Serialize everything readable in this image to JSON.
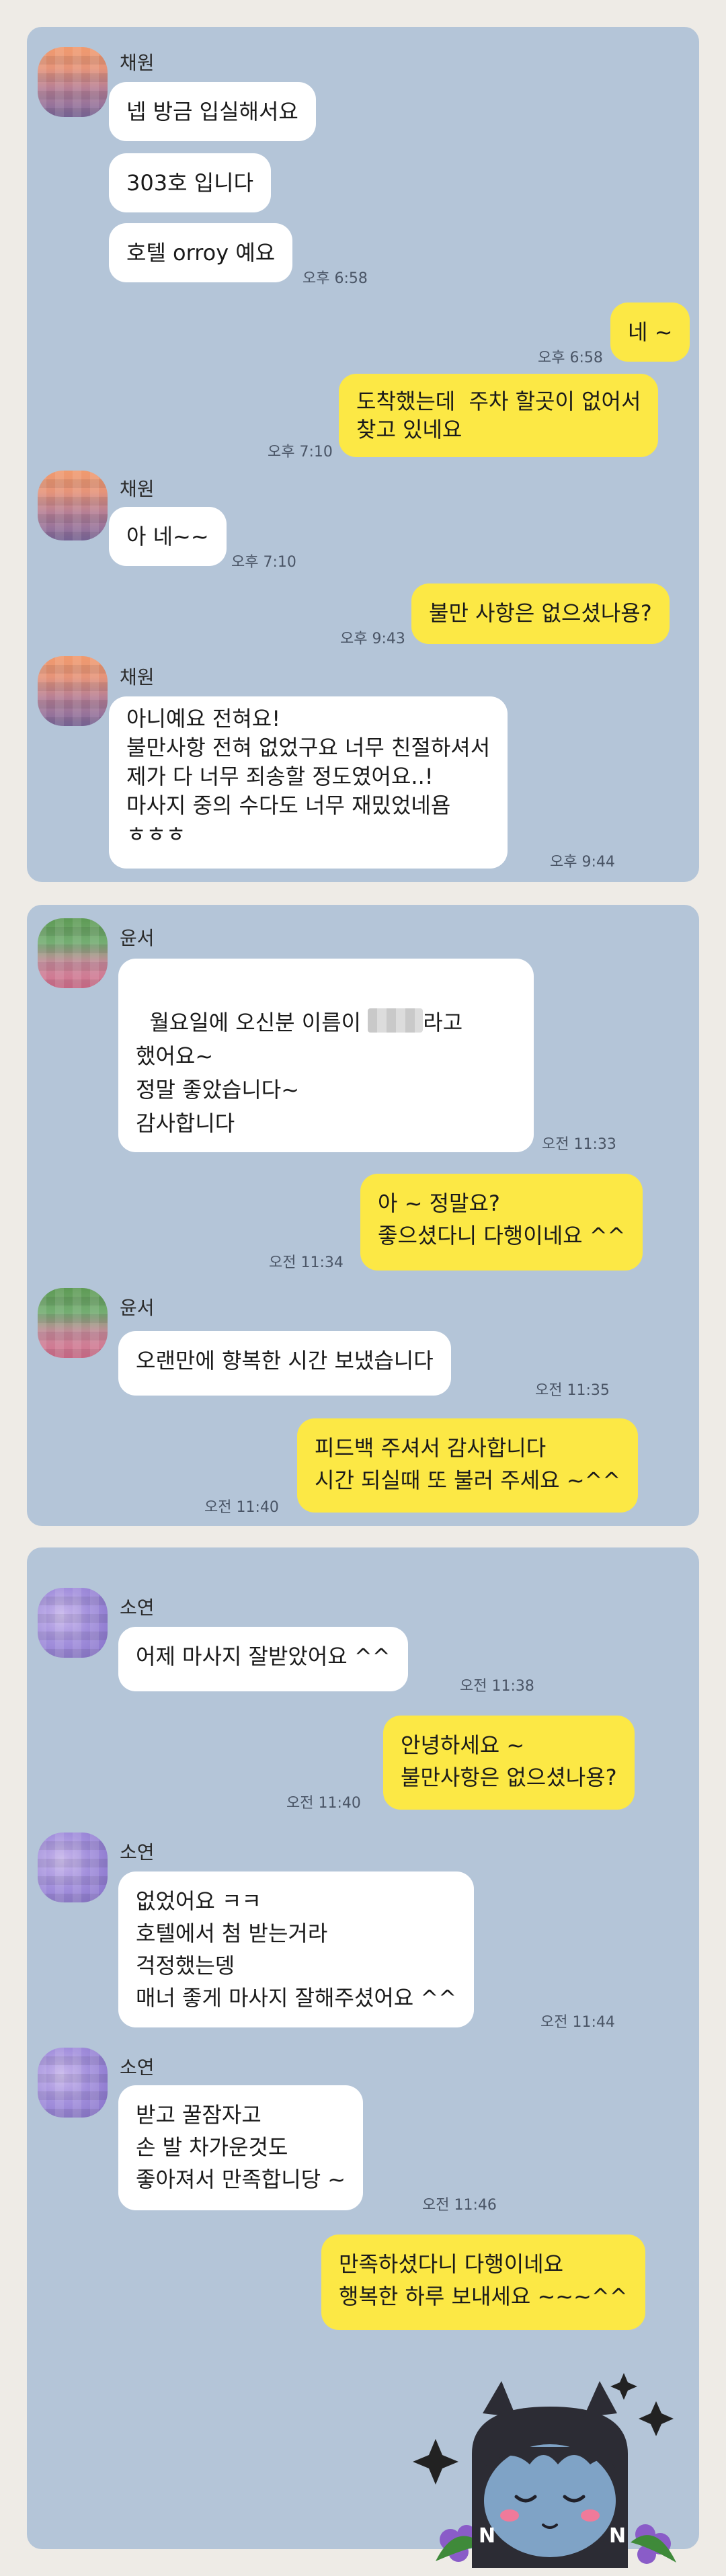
{
  "chat1": {
    "sender": "채원",
    "m1": "넵 방금 입실해서요",
    "m2": "303호 입니다",
    "m3": "호텔 orroy 예요",
    "t3": "오후 6:58",
    "o1": "네 ~",
    "to1": "오후 6:58",
    "o2": "도착했는데  주차 할곳이 없어서\n찾고 있네요",
    "to2": "오후 7:10",
    "sender2": "채원",
    "m4": "아 네~~",
    "t4": "오후 7:10",
    "o3": "불만 사항은 없으셨나용?",
    "to3": "오후 9:43",
    "sender3": "채원",
    "m5": "아니예요 전혀요!\n불만사항 전혀 없었구요 너무 친절하셔서\n제가 다 너무 죄송할 정도였어요..!\n마사지 중의 수다도 너무 재밌었네욤\nㅎㅎㅎ",
    "t5": "오후 9:44"
  },
  "chat2": {
    "sender": "윤서",
    "m1a": "월요일에 오신분 이름이 ",
    "m1b": "라고",
    "m1c": "했어요~\n정말 좋았습니다~\n감사합니다",
    "t1": "오전 11:33",
    "o1": "아 ~ 정말요?\n좋으셨다니 다행이네요 ^^",
    "to1": "오전 11:34",
    "sender2": "윤서",
    "m2": "오랜만에 향복한 시간 보냈습니다",
    "t2": "오전 11:35",
    "o2": "피드백 주셔서 감사합니다\n시간 되실때 또 불러 주세요 ~^^",
    "to2": "오전 11:40"
  },
  "chat3": {
    "sender": "소연",
    "m1": "어제 마사지 잘받았어요 ^^",
    "t1": "오전 11:38",
    "o1": "안녕하세요 ~\n불만사항은 없으셨나용?",
    "to1": "오전 11:40",
    "sender2": "소연",
    "m2": "없었어요 ㅋㅋ\n호텔에서 첨 받는거라\n걱정했는뎅\n매너 좋게 마사지 잘해주셨어요 ^^",
    "t2": "오전 11:44",
    "sender3": "소연",
    "m3": "받고 꿀잠자고\n손 발 차가운것도\n좋아져서 만족합니당 ~",
    "t3": "오전 11:46",
    "o2": "만족하셨다니 다행이네요\n행복한 하루 보내세요 ~~~^^"
  },
  "colors": {
    "panel": "#b4c5d8",
    "outgoing": "#fce845",
    "incoming": "#ffffff",
    "background": "#eeebe6"
  }
}
